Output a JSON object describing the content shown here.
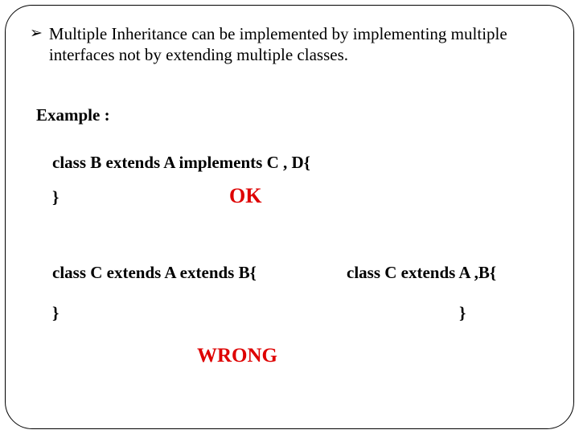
{
  "bullet": {
    "symbol": "➢",
    "text": "Multiple Inheritance can be implemented by implementing multiple interfaces not by extending multiple classes."
  },
  "example_label": "Example :",
  "decl_ok": "class B extends A implements C , D{",
  "close_brace": "}",
  "ok_label": "OK",
  "decl_wrong_left": "class C extends A extends B{",
  "decl_wrong_right": "class C extends A ,B{",
  "wrong_label": "WRONG"
}
